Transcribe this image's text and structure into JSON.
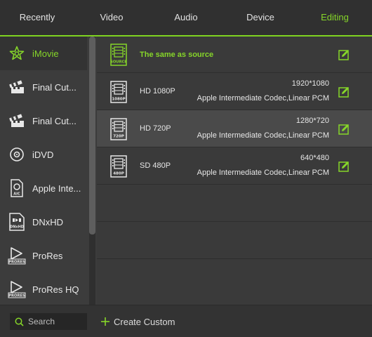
{
  "tabs": [
    {
      "label": "Recently"
    },
    {
      "label": "Video"
    },
    {
      "label": "Audio"
    },
    {
      "label": "Device"
    },
    {
      "label": "Editing"
    }
  ],
  "active_tab": "Editing",
  "accent_color": "#86d629",
  "sidebar": {
    "items": [
      {
        "label": "iMovie",
        "icon": "imovie-star-icon"
      },
      {
        "label": "Final Cut...",
        "icon": "clapperboard-icon"
      },
      {
        "label": "Final Cut...",
        "icon": "clapperboard-icon"
      },
      {
        "label": "iDVD",
        "icon": "disc-icon"
      },
      {
        "label": "Apple Inte...",
        "icon": "aic-file-icon"
      },
      {
        "label": "DNxHD",
        "icon": "dnxhd-icon"
      },
      {
        "label": "ProRes",
        "icon": "prores-icon"
      },
      {
        "label": "ProRes HQ",
        "icon": "prores-icon"
      }
    ]
  },
  "presets": {
    "source": {
      "label": "The same as source",
      "badge": "SOURCE"
    },
    "rows": [
      {
        "badge": "1080P",
        "name": "HD 1080P",
        "resolution": "1920*1080",
        "codec": "Apple Intermediate Codec,Linear PCM"
      },
      {
        "badge": "720P",
        "name": "HD 720P",
        "resolution": "1280*720",
        "codec": "Apple Intermediate Codec,Linear PCM"
      },
      {
        "badge": "480P",
        "name": "SD 480P",
        "resolution": "640*480",
        "codec": "Apple Intermediate Codec,Linear PCM"
      }
    ]
  },
  "bottom": {
    "search_placeholder": "Search",
    "create_custom_label": "Create Custom"
  }
}
